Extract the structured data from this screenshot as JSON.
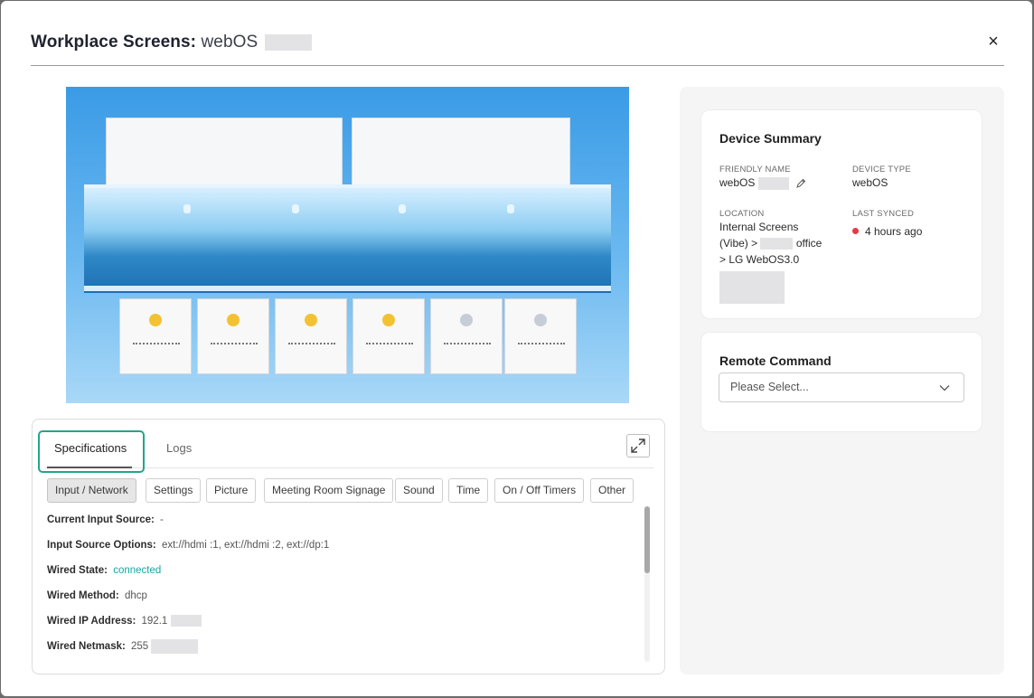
{
  "modal": {
    "title": "Workplace Screens:",
    "device_name": "webOS",
    "close_symbol": "×",
    "close_icon": "close-icon"
  },
  "tabs": [
    {
      "label": "Specifications",
      "active": true
    },
    {
      "label": "Logs",
      "active": false
    }
  ],
  "expand_icon": "expand-icon",
  "categories": [
    {
      "label": "Input / Network",
      "active": true
    },
    {
      "label": "Settings"
    },
    {
      "label": "Picture"
    },
    {
      "label": "Meeting Room Signage"
    },
    {
      "label": "Sound"
    },
    {
      "label": "Time"
    },
    {
      "label": "On / Off Timers"
    },
    {
      "label": "Other"
    }
  ],
  "specs": [
    {
      "key": "Current Input Source:",
      "value": "-"
    },
    {
      "key": "Input Source Options:",
      "value": "ext://hdmi :1, ext://hdmi :2, ext://dp:1"
    },
    {
      "key": "Wired State:",
      "value": "connected",
      "status": "ok"
    },
    {
      "key": "Wired Method:",
      "value": "dhcp"
    },
    {
      "key": "Wired IP Address:",
      "value": "192.1"
    },
    {
      "key": "Wired Netmask:",
      "value": "255"
    }
  ],
  "device_summary": {
    "title": "Device Summary",
    "friendly_name_label": "FRIENDLY NAME",
    "friendly_name": "webOS",
    "device_type_label": "DEVICE TYPE",
    "device_type": "webOS",
    "location_label": "LOCATION",
    "location_line1": "Internal Screens",
    "location_line2_a": "(Vibe) >",
    "location_line2_b": "office",
    "location_line3": "> LG WebOS3.0",
    "last_synced_label": "LAST SYNCED",
    "last_synced": "4 hours ago",
    "status_color": "#e63946"
  },
  "remote_command": {
    "title": "Remote Command",
    "placeholder": "Please Select..."
  },
  "colors": {
    "accent_highlight": "#22a68a",
    "connected": "#1aa3a3"
  }
}
